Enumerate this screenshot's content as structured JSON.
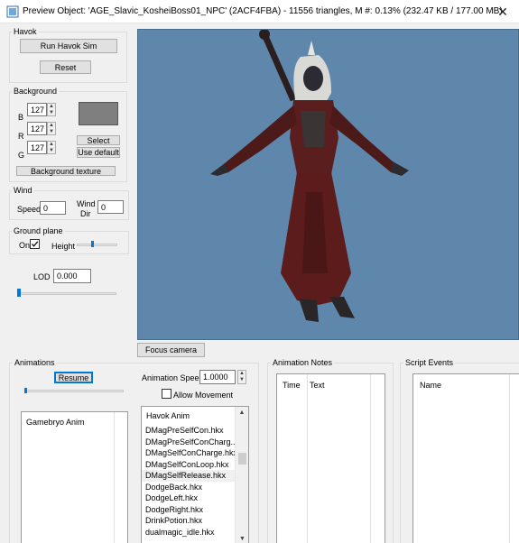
{
  "window": {
    "title": "Preview Object: 'AGE_Slavic_KosheiBoss01_NPC' (2ACF4FBA) - 11556 triangles, M #: 0.13% (232.47 KB / 177.00 MB)",
    "close_glyph": "✕"
  },
  "havok": {
    "group_label": "Havok",
    "run_label": "Run Havok Sim",
    "reset_label": "Reset"
  },
  "background": {
    "group_label": "Background",
    "b_label": "B",
    "b_value": "127",
    "r_label": "R",
    "r_value": "127",
    "g_label": "G",
    "g_value": "127",
    "swatch_color": "#7f7f7f",
    "select_label": "Select",
    "use_default_label": "Use default",
    "texture_label": "Background texture"
  },
  "wind": {
    "group_label": "Wind",
    "speed_label": "Speed",
    "speed_value": "0",
    "dir_label_1": "Wind",
    "dir_label_2": "Dir",
    "dir_value": "0"
  },
  "ground_plane": {
    "group_label": "Ground plane",
    "on_label": "On",
    "on_checked": true,
    "height_label": "Height"
  },
  "lod": {
    "label": "LOD",
    "value": "0.000"
  },
  "viewport": {
    "background_color": "#5f87ab"
  },
  "focus_camera_label": "Focus camera",
  "animations": {
    "group_label": "Animations",
    "resume_label": "Resume",
    "speed_label": "Animation Speed",
    "speed_value": "1.0000",
    "allow_movement_label": "Allow Movement",
    "allow_movement_checked": false,
    "gamebryo_header": "Gamebryo Anim",
    "havok_header": "Havok Anim",
    "havok_items": [
      "DMagPreSelfCon.hkx",
      "DMagPreSelfConCharg...",
      "DMagSelfConCharge.hkx",
      "DMagSelfConLoop.hkx",
      "DMagSelfRelease.hkx",
      "DodgeBack.hkx",
      "DodgeLeft.hkx",
      "DodgeRight.hkx",
      "DrinkPotion.hkx",
      "dualmagic_idle.hkx"
    ]
  },
  "animation_notes": {
    "group_label": "Animation Notes",
    "col_time": "Time",
    "col_text": "Text"
  },
  "script_events": {
    "group_label": "Script Events",
    "col_name": "Name"
  }
}
